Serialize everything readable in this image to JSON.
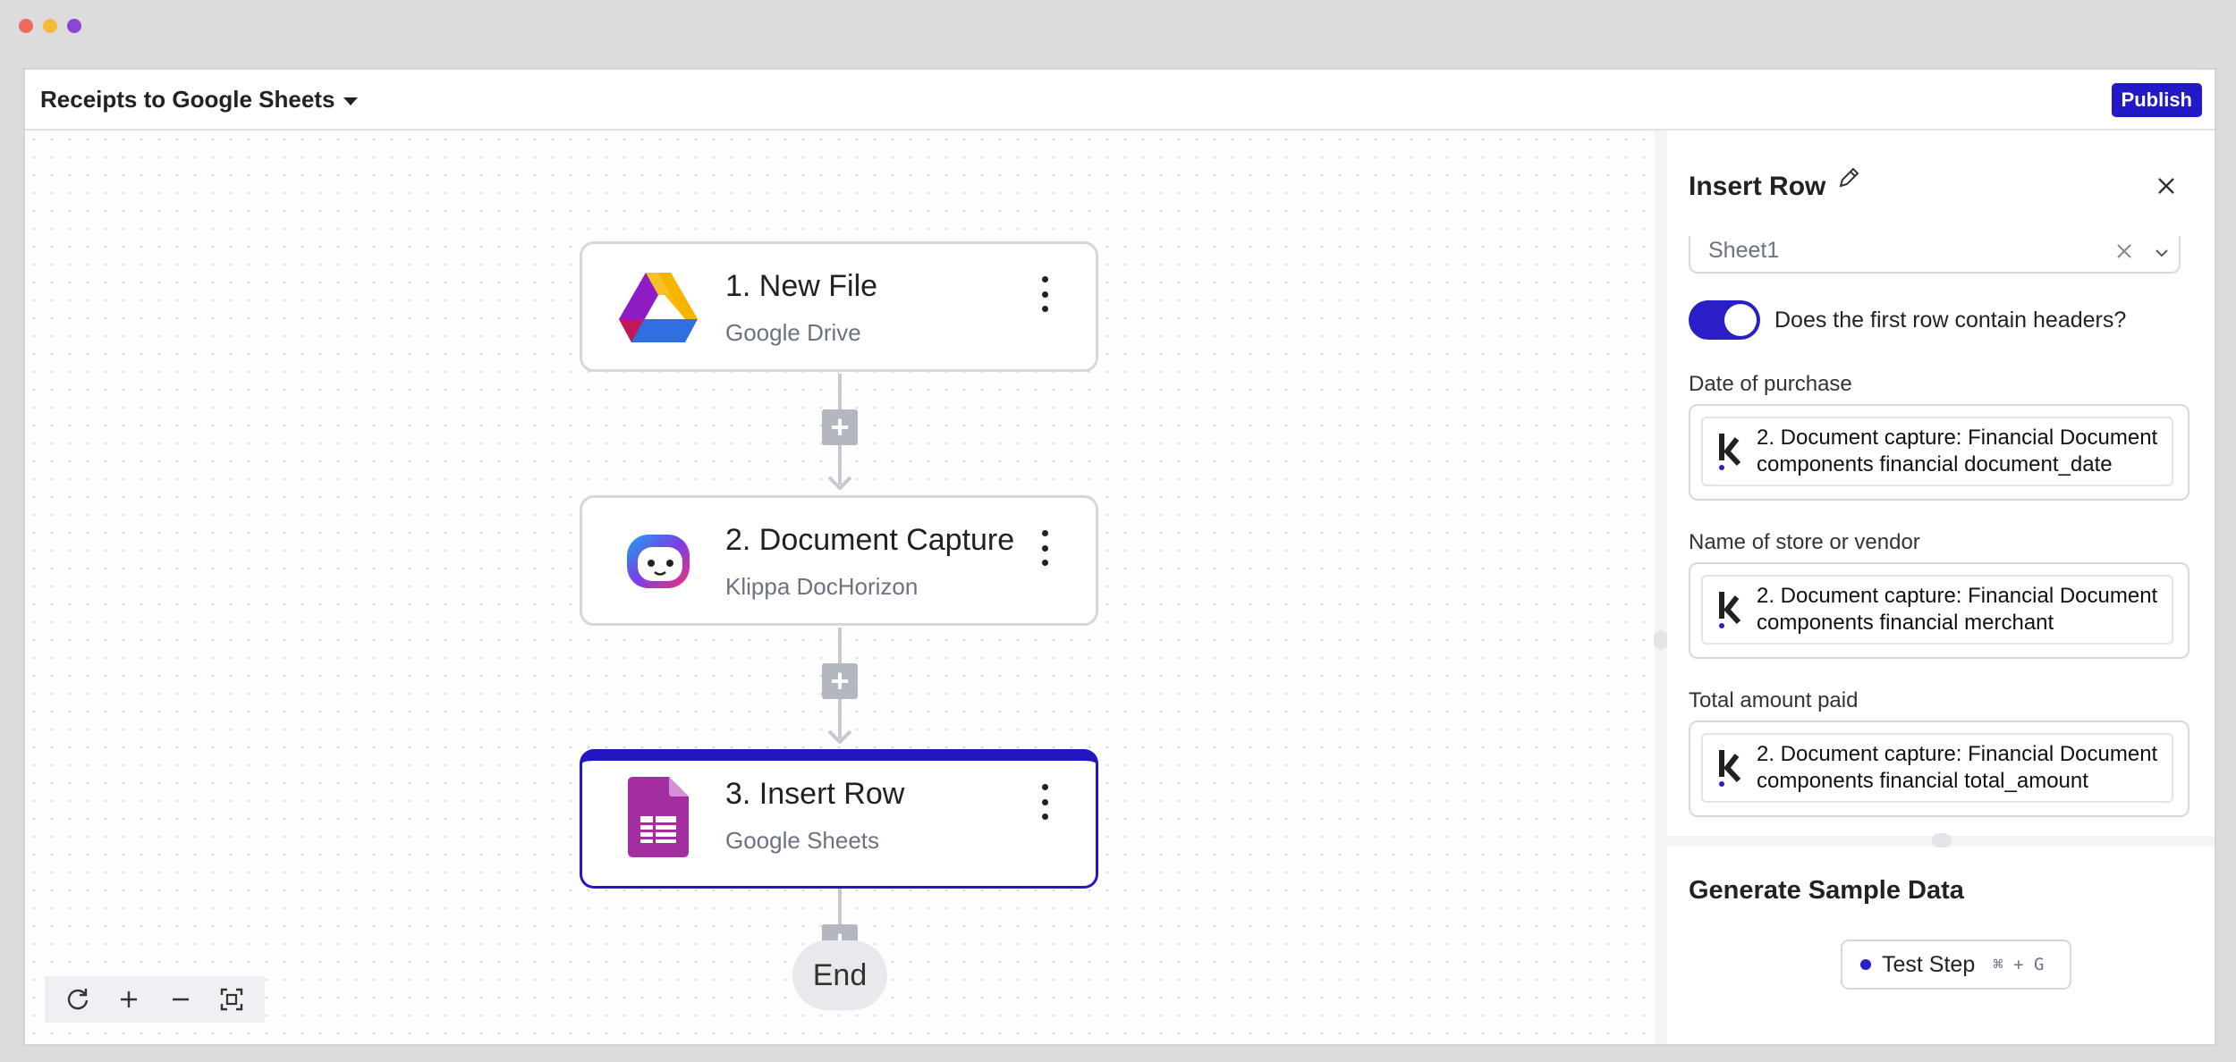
{
  "window": {
    "dot_colors": [
      "#ef6a5d",
      "#f5b83d",
      "#8e44d6"
    ]
  },
  "header": {
    "workflow_title": "Receipts to Google Sheets",
    "publish_label": "Publish"
  },
  "flow": {
    "nodes": [
      {
        "title": "1. New File",
        "subtitle": "Google Drive",
        "icon": "google-drive-icon"
      },
      {
        "title": "2. Document Capture",
        "subtitle": "Klippa DocHorizon",
        "icon": "klippa-dochorizon-icon"
      },
      {
        "title": "3. Insert Row",
        "subtitle": "Google Sheets",
        "icon": "google-sheets-icon"
      }
    ],
    "add_step_symbol": "+",
    "end_label": "End"
  },
  "canvas_controls": [
    "refresh-icon",
    "zoom-in-icon",
    "zoom-out-icon",
    "fit-view-icon"
  ],
  "panel": {
    "title": "Insert Row",
    "sheet_select_value": "Sheet1",
    "toggle_label": "Does the first row contain headers?",
    "toggle_on": true,
    "fields": [
      {
        "label": "Date of purchase",
        "value_line1": "2. Document capture: Financial Document",
        "value_line2": "components financial document_date"
      },
      {
        "label": "Name of store or vendor",
        "value_line1": "2. Document capture: Financial Document",
        "value_line2": "components financial merchant"
      },
      {
        "label": "Total amount paid",
        "value_line1": "2. Document capture: Financial Document",
        "value_line2": "components financial total_amount"
      }
    ],
    "sample_title": "Generate Sample Data",
    "test_button": {
      "label": "Test Step",
      "shortcut": "⌘ + G"
    }
  },
  "colors": {
    "accent": "#2417c2",
    "connector": "#c6c9cf",
    "plus_button": "#b2b7c0"
  }
}
